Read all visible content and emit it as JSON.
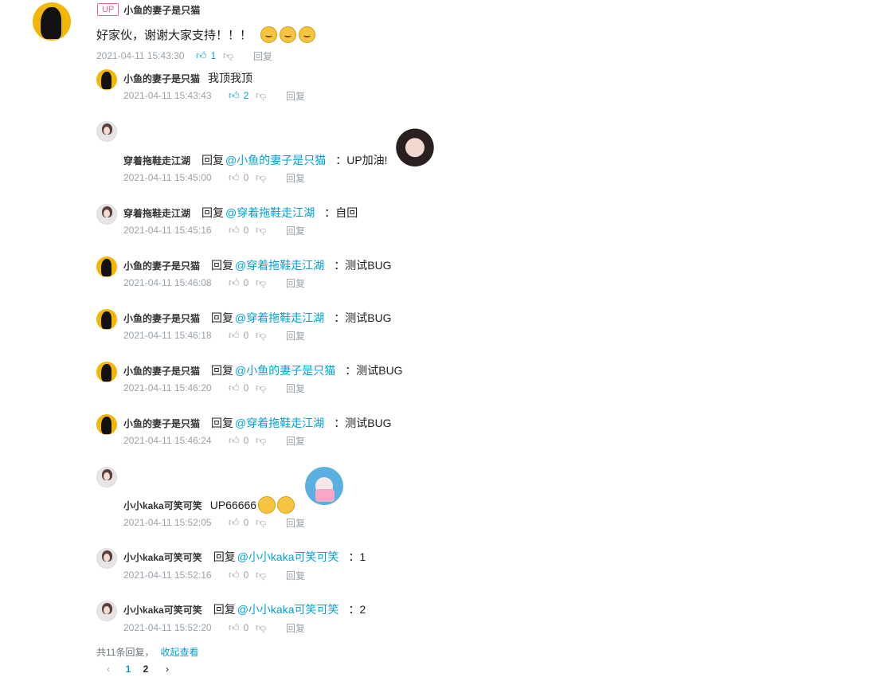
{
  "main_comment": {
    "badge": "UP",
    "username": "小鱼的妻子是只猫",
    "text": "好家伙，谢谢大家支持！！！",
    "emoji_count": 3,
    "time": "2021-04-11 15:43:30",
    "likes": "1",
    "reply_label": "回复"
  },
  "replies": [
    {
      "username": "小鱼的妻子是只猫",
      "avatar": "yellow",
      "prefix": "",
      "mention": "",
      "text": "我顶我顶",
      "time": "2021-04-11 15:43:43",
      "likes": "2",
      "liked": true,
      "reply_label": "回复"
    },
    {
      "username": "穿着拖鞋走江湖",
      "avatar": "girl",
      "prefix": "回复",
      "mention": "@小鱼的妻子是只猫",
      "text": "：UP加油!",
      "time": "2021-04-11 15:45:00",
      "likes": "0",
      "reply_label": "回复",
      "sticker": "dark"
    },
    {
      "username": "穿着拖鞋走江湖",
      "avatar": "girl",
      "prefix": "回复",
      "mention": "@穿着拖鞋走江湖",
      "text": "：自回",
      "time": "2021-04-11 15:45:16",
      "likes": "0",
      "reply_label": "回复"
    },
    {
      "username": "小鱼的妻子是只猫",
      "avatar": "yellow",
      "prefix": "回复",
      "mention": "@穿着拖鞋走江湖",
      "text": "：测试BUG",
      "time": "2021-04-11 15:46:08",
      "likes": "0",
      "reply_label": "回复"
    },
    {
      "username": "小鱼的妻子是只猫",
      "avatar": "yellow",
      "prefix": "回复",
      "mention": "@穿着拖鞋走江湖",
      "text": "：测试BUG",
      "time": "2021-04-11 15:46:18",
      "likes": "0",
      "reply_label": "回复"
    },
    {
      "username": "小鱼的妻子是只猫",
      "avatar": "yellow",
      "prefix": "回复",
      "mention": "@小鱼的妻子是只猫",
      "text": "：测试BUG",
      "time": "2021-04-11 15:46:20",
      "likes": "0",
      "reply_label": "回复"
    },
    {
      "username": "小鱼的妻子是只猫",
      "avatar": "yellow",
      "prefix": "回复",
      "mention": "@穿着拖鞋走江湖",
      "text": "：测试BUG",
      "time": "2021-04-11 15:46:24",
      "likes": "0",
      "reply_label": "回复"
    },
    {
      "username": "小小kaka可笑可笑",
      "avatar": "girl",
      "prefix": "",
      "mention": "",
      "text": "UP66666",
      "time": "2021-04-11 15:52:05",
      "likes": "0",
      "reply_label": "回复",
      "sticker": "miku",
      "emoji_count": 2
    },
    {
      "username": "小小kaka可笑可笑",
      "avatar": "girl",
      "prefix": "回复",
      "mention": "@小小kaka可笑可笑",
      "text": "：1",
      "time": "2021-04-11 15:52:16",
      "likes": "0",
      "reply_label": "回复"
    },
    {
      "username": "小小kaka可笑可笑",
      "avatar": "girl",
      "prefix": "回复",
      "mention": "@小小kaka可笑可笑",
      "text": "：2",
      "time": "2021-04-11 15:52:20",
      "likes": "0",
      "reply_label": "回复"
    }
  ],
  "footer": {
    "count_text": "共11条回复，",
    "collapse_label": "收起查看"
  },
  "pagination": {
    "prev": "‹",
    "pages": [
      "1",
      "2"
    ],
    "current": "1",
    "next": "›"
  },
  "colors": {
    "accent": "#00a1d6",
    "up_badge": "#f25d8e",
    "meta": "#99a2aa"
  }
}
